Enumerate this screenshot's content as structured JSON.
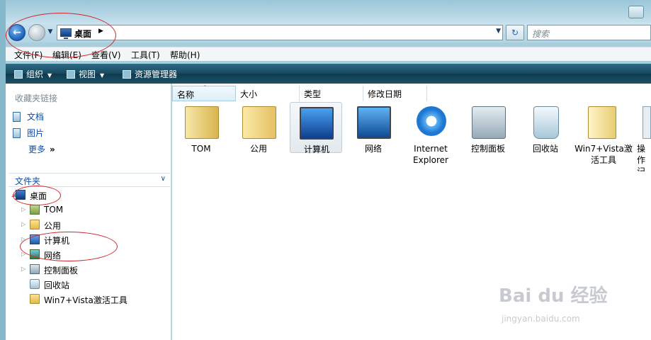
{
  "address": {
    "location": "桌面",
    "search_placeholder": "搜索"
  },
  "menubar": [
    "文件(F)",
    "编辑(E)",
    "查看(V)",
    "工具(T)",
    "帮助(H)"
  ],
  "commandbar": {
    "organize": "组织",
    "views": "视图",
    "explorer": "资源管理器"
  },
  "navpane": {
    "favorites_header": "收藏夹链接",
    "favorites": [
      "文档",
      "图片"
    ],
    "more": "更多",
    "more_arrows": "»",
    "folders_label": "文件夹"
  },
  "tree": [
    {
      "label": "桌面",
      "icon": "desktop-icon"
    },
    {
      "label": "TOM",
      "icon": "user-folder-icon"
    },
    {
      "label": "公用",
      "icon": "folder-icon"
    },
    {
      "label": "计算机",
      "icon": "computer-icon"
    },
    {
      "label": "网络",
      "icon": "network-icon"
    },
    {
      "label": "控制面板",
      "icon": "control-panel-icon"
    },
    {
      "label": "回收站",
      "icon": "recycle-bin-icon"
    },
    {
      "label": "Win7+Vista激活工具",
      "icon": "folder-icon"
    }
  ],
  "columns": [
    "名称",
    "大小",
    "类型",
    "修改日期"
  ],
  "items": [
    {
      "label": "TOM",
      "icon": "user-folder-icon"
    },
    {
      "label": "公用",
      "icon": "folder-icon"
    },
    {
      "label": "计算机",
      "icon": "computer-icon"
    },
    {
      "label": "网络",
      "icon": "network-icon"
    },
    {
      "label": "Internet Explorer",
      "icon": "internet-explorer-icon"
    },
    {
      "label": "控制面板",
      "icon": "control-panel-icon"
    },
    {
      "label": "回收站",
      "icon": "recycle-bin-icon"
    },
    {
      "label": "Win7+Vista激活工具",
      "icon": "folder-icon"
    },
    {
      "label": "操作记",
      "icon": "shortcut-icon"
    }
  ],
  "watermark": {
    "main": "Bai du 经验",
    "sub": "jingyan.baidu.com"
  },
  "colors": {
    "link": "#0f4aa8",
    "annotation": "#d4252f",
    "commandbar": "#17485e"
  }
}
